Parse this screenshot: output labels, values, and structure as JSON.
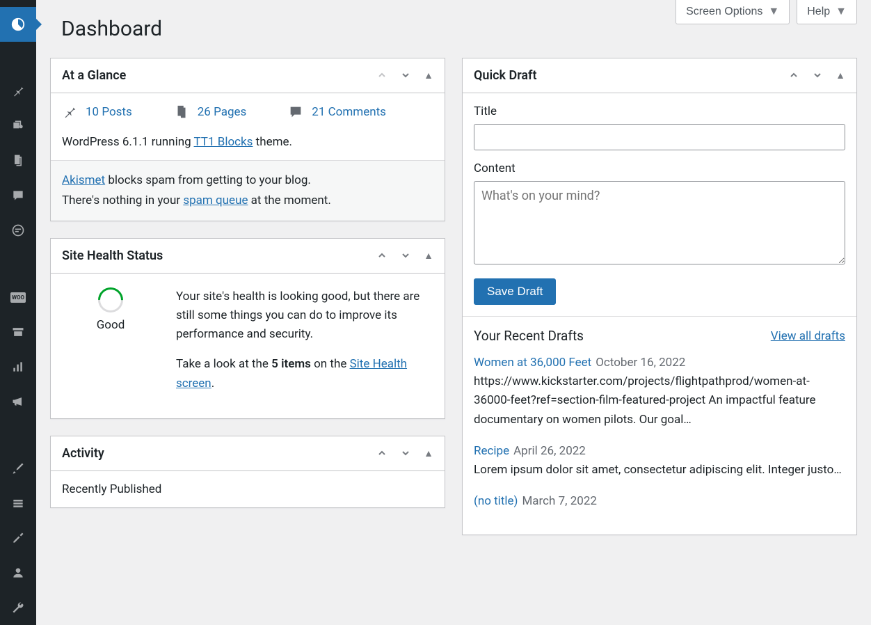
{
  "topbar": {
    "screen_options": "Screen Options",
    "help": "Help"
  },
  "page_title": "Dashboard",
  "at_a_glance": {
    "title": "At a Glance",
    "posts": "10 Posts",
    "pages": "26 Pages",
    "comments": "21 Comments",
    "version_prefix": "WordPress 6.1.1 running ",
    "theme_name": "TT1 Blocks",
    "version_suffix": " theme.",
    "akismet_link": "Akismet",
    "akismet_text": " blocks spam from getting to your blog.",
    "akismet_line2a": "There's nothing in your ",
    "akismet_spam_link": "spam queue",
    "akismet_line2b": " at the moment."
  },
  "site_health": {
    "title": "Site Health Status",
    "status": "Good",
    "desc": "Your site's health is looking good, but there are still some things you can do to improve its performance and security.",
    "take_look_a": "Take a look at the ",
    "take_look_b": "5 items",
    "take_look_c": " on the ",
    "screen_link": "Site Health screen",
    "period": "."
  },
  "activity": {
    "title": "Activity",
    "recent": "Recently Published"
  },
  "quick_draft": {
    "title": "Quick Draft",
    "title_label": "Title",
    "content_label": "Content",
    "placeholder": "What's on your mind?",
    "save": "Save Draft",
    "recent_drafts": "Your Recent Drafts",
    "view_all": "View all drafts",
    "drafts": [
      {
        "title": "Women at 36,000 Feet",
        "date": "October 16, 2022",
        "excerpt": "https://www.kickstarter.com/projects/flightpathprod/women-at-36000-feet?ref=section-film-featured-project An impactful feature documentary on women pilots. Our goal…"
      },
      {
        "title": "Recipe",
        "date": "April 26, 2022",
        "excerpt": "Lorem ipsum dolor sit amet, consectetur adipiscing elit. Integer justo…"
      },
      {
        "title": "(no title)",
        "date": "March 7, 2022",
        "excerpt": ""
      }
    ]
  }
}
